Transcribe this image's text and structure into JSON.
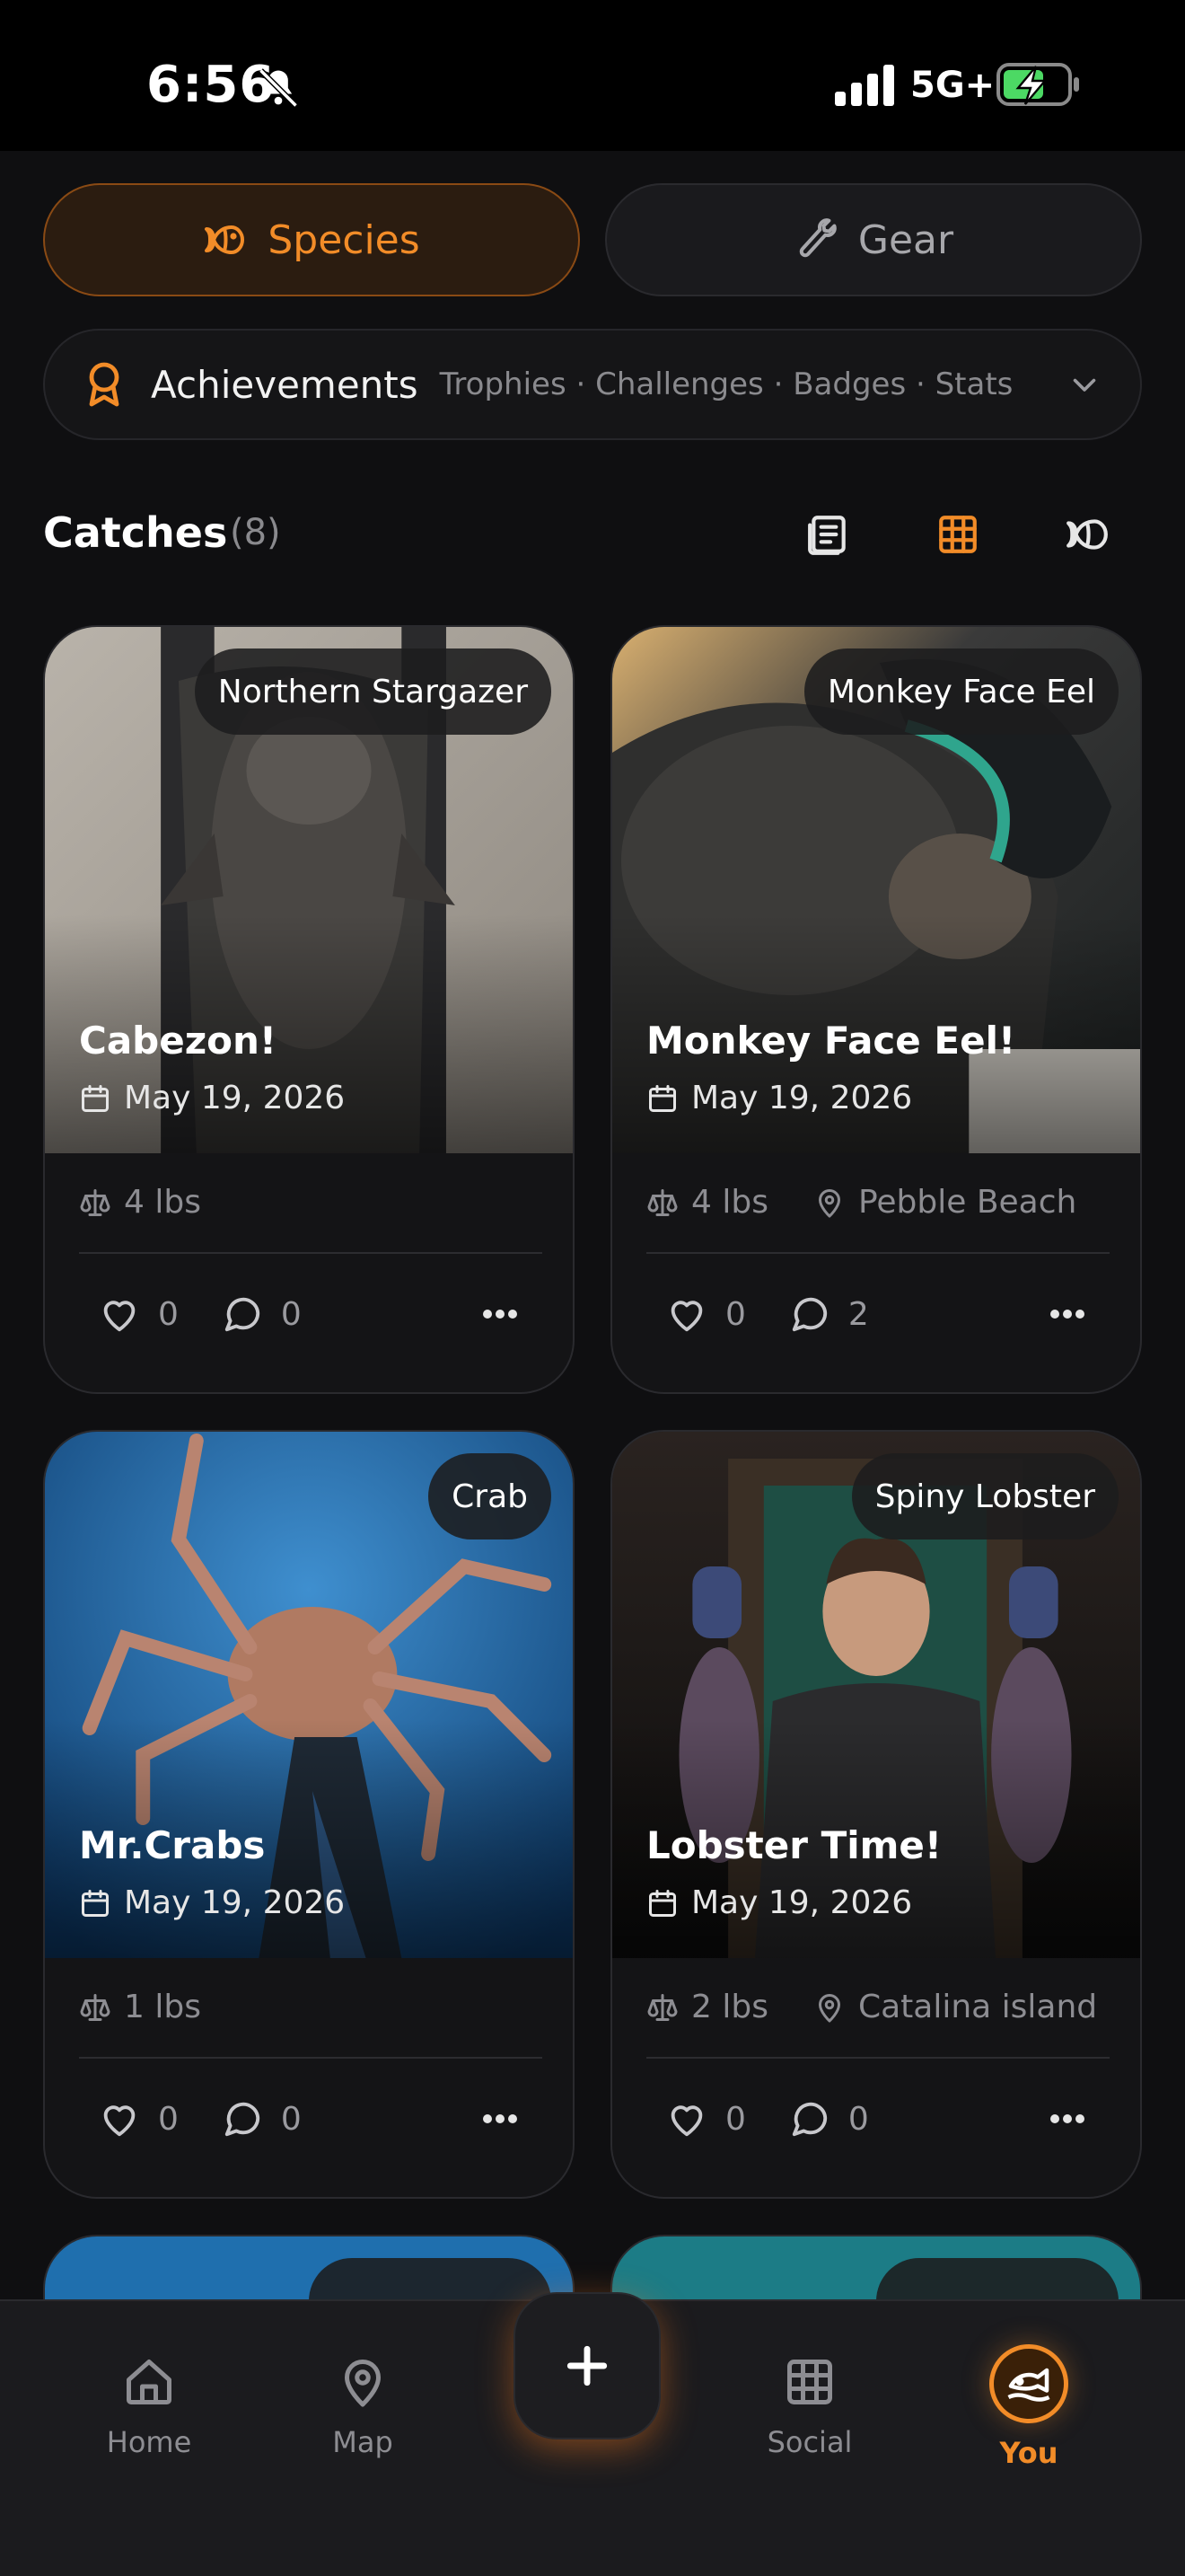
{
  "status_bar": {
    "time": "6:56",
    "network": "5G+"
  },
  "segments": {
    "species_label": "Species",
    "gear_label": "Gear"
  },
  "achievements": {
    "title": "Achievements",
    "subtitle": "Trophies · Challenges · Badges · Stats"
  },
  "catches": {
    "title": "Catches",
    "count": "(8)"
  },
  "cards": [
    {
      "species": "Northern Stargazer",
      "title": "Cabezon!",
      "date": "May 19, 2026",
      "weight": "4 lbs",
      "location": "",
      "likes": "0",
      "comments": "0"
    },
    {
      "species": "Monkey Face Eel",
      "title": "Monkey Face Eel!",
      "date": "May 19, 2026",
      "weight": "4 lbs",
      "location": "Pebble Beach",
      "likes": "0",
      "comments": "2"
    },
    {
      "species": "Crab",
      "title": "Mr.Crabs",
      "date": "May 19, 2026",
      "weight": "1 lbs",
      "location": "",
      "likes": "0",
      "comments": "0"
    },
    {
      "species": "Spiny Lobster",
      "title": "Lobster Time!",
      "date": "May 19, 2026",
      "weight": "2 lbs",
      "location": "Catalina island",
      "likes": "0",
      "comments": "0"
    }
  ],
  "nav": {
    "home": "Home",
    "map": "Map",
    "social": "Social",
    "you": "You"
  },
  "colors": {
    "accent": "#f28c28",
    "background": "#0f0f11",
    "card": "#141416"
  }
}
